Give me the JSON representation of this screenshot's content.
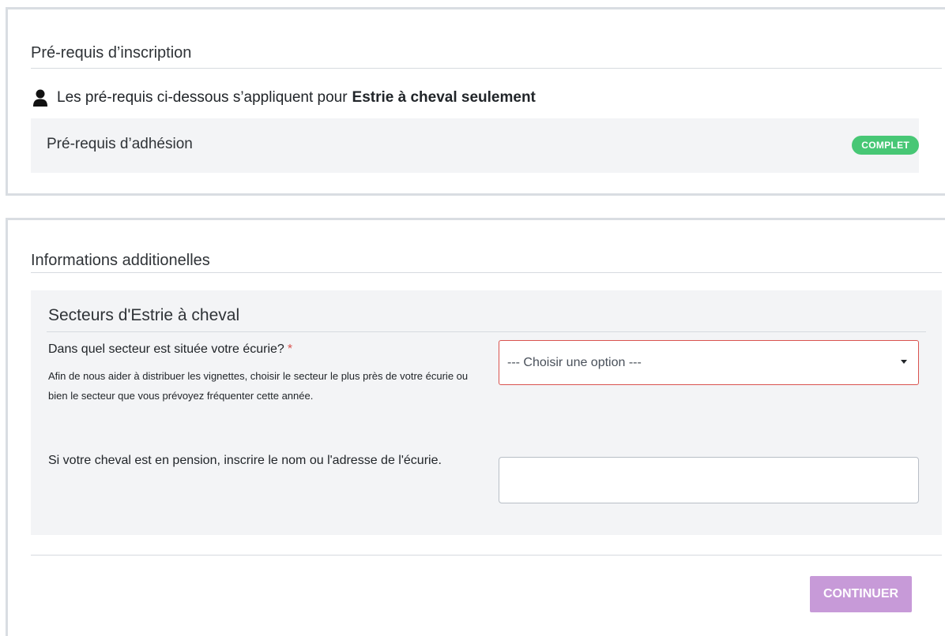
{
  "prerequisites": {
    "title": "Pré-requis d’inscription",
    "notice_text": "Les pré-requis ci-dessous s’appliquent pour",
    "notice_org": "Estrie à cheval seulement",
    "items": [
      {
        "label": "Pré-requis d’adhésion",
        "status": "COMPLET",
        "status_color": "#47c775"
      }
    ]
  },
  "additional_info": {
    "title": "Informations additionelles",
    "section_title": "Secteurs d'Estrie à cheval",
    "q1": {
      "label": "Dans quel secteur est située votre écurie?",
      "required_mark": "*",
      "help": "Afin de nous aider à distribuer les vignettes, choisir le secteur le plus près de votre écurie ou bien le secteur que vous prévoyez fréquenter cette année.",
      "selected": "--- Choisir une option ---"
    },
    "q2": {
      "label": "Si votre cheval est en pension, inscrire le nom ou l'adresse de l'écurie.",
      "value": ""
    }
  },
  "actions": {
    "continue_label": "CONTINUER",
    "continue_color": "#c79ad8"
  }
}
